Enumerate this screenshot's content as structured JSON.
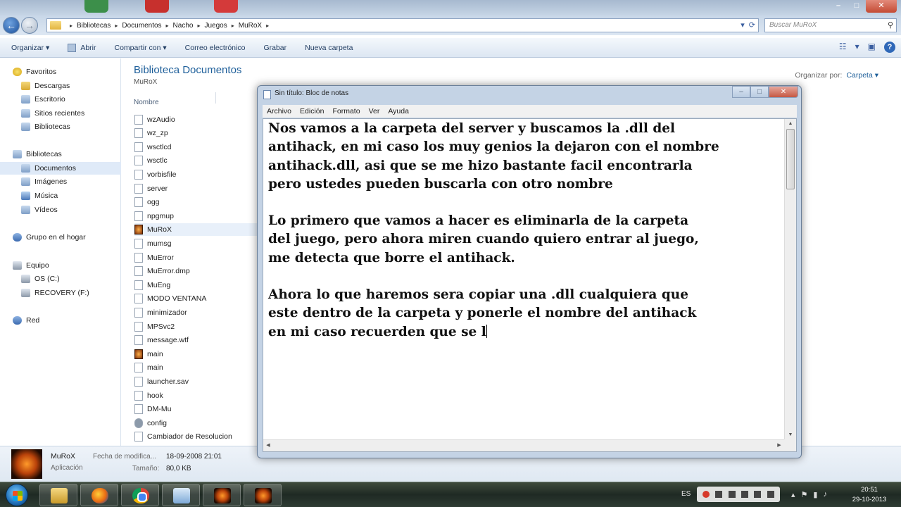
{
  "explorer": {
    "breadcrumb": [
      "Bibliotecas",
      "Documentos",
      "Nacho",
      "Juegos",
      "MuRoX"
    ],
    "search_placeholder": "Buscar MuRoX",
    "toolbar": [
      "Organizar",
      "Abrir",
      "Compartir con",
      "Correo electrónico",
      "Grabar",
      "Nueva carpeta"
    ],
    "nav": {
      "favoritos": "Favoritos",
      "descargas": "Descargas",
      "escritorio": "Escritorio",
      "sitios": "Sitios recientes",
      "bibliotecas_fav": "Bibliotecas",
      "bibliotecas": "Bibliotecas",
      "documentos": "Documentos",
      "imagenes": "Imágenes",
      "musica": "Música",
      "videos": "Vídeos",
      "grupo": "Grupo en el hogar",
      "equipo": "Equipo",
      "os": "OS (C:)",
      "recovery": "RECOVERY (F:)",
      "red": "Red"
    },
    "library_title": "Biblioteca Documentos",
    "library_sub": "MuRoX",
    "arrange_label": "Organizar por:",
    "arrange_value": "Carpeta",
    "column_name": "Nombre",
    "files": [
      "wzAudio",
      "wz_zp",
      "wsctlcd",
      "wsctlc",
      "vorbisfile",
      "server",
      "ogg",
      "npgmup",
      "MuRoX",
      "mumsg",
      "MuError",
      "MuError.dmp",
      "MuEng",
      "MODO VENTANA",
      "minimizador",
      "MPSvc2",
      "message.wtf",
      "main",
      "main",
      "launcher.sav",
      "hook",
      "DM-Mu",
      "config",
      "Cambiador de Resolucion"
    ],
    "details": {
      "name": "MuRoX",
      "type": "Aplicación",
      "mod_label": "Fecha de modifica...",
      "mod_value": "18-09-2008 21:01",
      "size_label": "Tamaño:",
      "size_value": "80,0 KB"
    }
  },
  "notepad": {
    "title": "Sin título: Bloc de notas",
    "menu": [
      "Archivo",
      "Edición",
      "Formato",
      "Ver",
      "Ayuda"
    ],
    "lines": [
      "Nos vamos a la carpeta del server y buscamos la .dll del",
      "antihack, en mi caso los muy genios la dejaron con el nombre",
      "antihack.dll, asi que se me hizo bastante facil encontrarla",
      "pero ustedes pueden buscarla con otro nombre",
      "",
      "Lo primero que vamos a hacer es eliminarla de la carpeta",
      "del juego, pero ahora miren cuando quiero entrar al juego,",
      "me detecta que borre el antihack.",
      "",
      "Ahora lo que haremos sera copiar una .dll cualquiera que",
      "este dentro de la carpeta y ponerle el nombre del antihack",
      "en mi caso recuerden que se l"
    ]
  },
  "taskbar": {
    "lang": "ES",
    "time": "20:51",
    "date": "29-10-2013"
  }
}
